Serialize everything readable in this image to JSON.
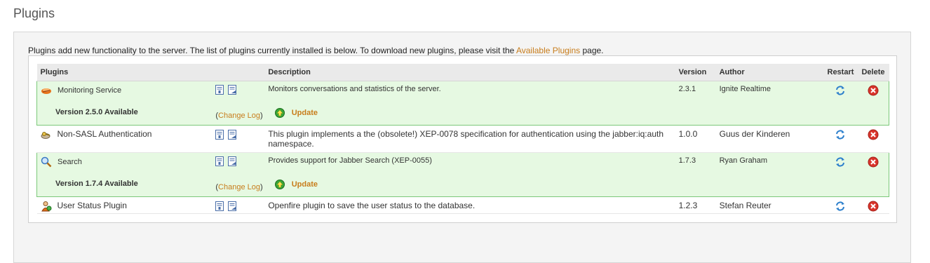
{
  "page": {
    "title": "Plugins",
    "intro_prefix": "Plugins add new functionality to the server. The list of plugins currently installed is below. To download new plugins, please visit the ",
    "intro_link": "Available Plugins",
    "intro_suffix": " page."
  },
  "table": {
    "headers": {
      "plugins": "Plugins",
      "description": "Description",
      "version": "Version",
      "author": "Author",
      "restart": "Restart",
      "delete": "Delete"
    },
    "rows": [
      {
        "name": "Monitoring Service",
        "icon": "monitoring-icon",
        "description": "Monitors conversations and statistics of the server.",
        "version": "2.3.1",
        "author": "Ignite Realtime",
        "update": {
          "available_text": "Version 2.5.0 Available",
          "changelog_open": "(",
          "changelog_label": "Change Log",
          "changelog_close": ")",
          "update_label": "Update"
        }
      },
      {
        "name": "Non-SASL Authentication",
        "icon": "key-icon",
        "description": "This plugin implements a the (obsolete!) XEP-0078 specification for authentication using the jabber:iq:auth namespace.",
        "version": "1.0.0",
        "author": "Guus der Kinderen"
      },
      {
        "name": "Search",
        "icon": "magnifier-icon",
        "description": "Provides support for Jabber Search (XEP-0055)",
        "version": "1.7.3",
        "author": "Ryan Graham",
        "update": {
          "available_text": "Version 1.7.4 Available",
          "changelog_open": "(",
          "changelog_label": "Change Log",
          "changelog_close": ")",
          "update_label": "Update"
        }
      },
      {
        "name": "User Status Plugin",
        "icon": "user-status-icon",
        "description": "Openfire plugin to save the user status to the database.",
        "version": "1.2.3",
        "author": "Stefan Reuter"
      }
    ]
  },
  "colors": {
    "link": "#c87d1c",
    "update_text": "#d2750e",
    "update_row_bg": "#e6f9e2",
    "update_row_border": "#7cc87a",
    "header_bg": "#eaeaea"
  }
}
